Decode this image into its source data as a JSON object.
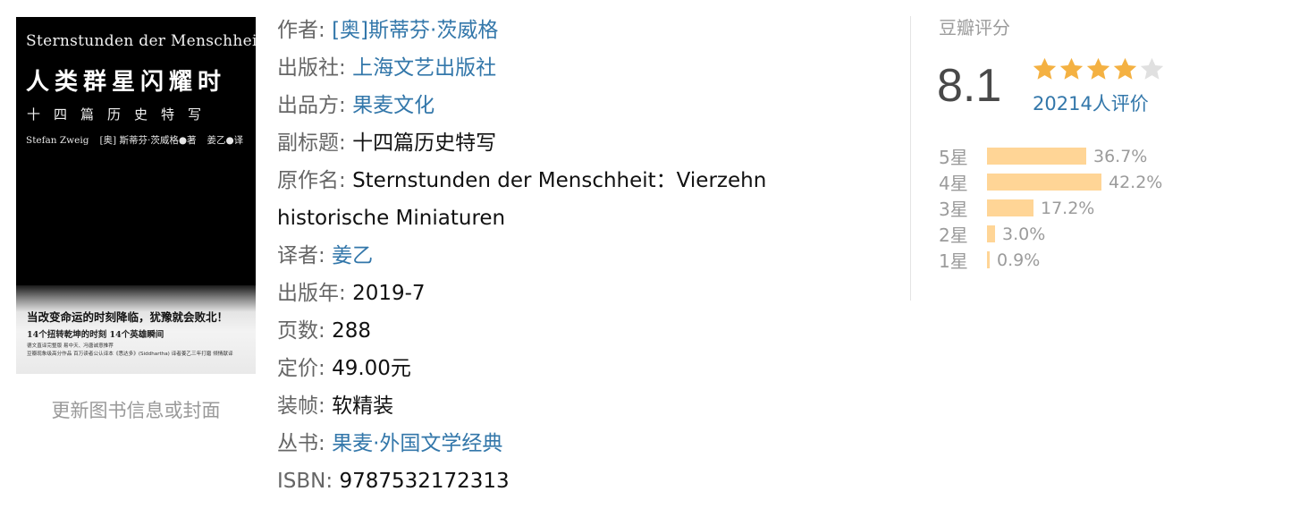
{
  "cover": {
    "en_title": "Sternstunden der Menschheit",
    "cn_title": "人类群星闪耀时",
    "subtitle": "十四篇历史特写",
    "author_en": "Stefan Zweig",
    "author_cn": "[奥] 斯蒂芬·茨威格●著",
    "translator_cn": "姜乙●译",
    "slogan": "当改变命运的时刻降临，犹豫就会败北！",
    "tagline": "14个扭转乾坤的时刻  14个英雄瞬间",
    "blurb_line1": "德文直译完整版 易中天、冯唐诚意推荐",
    "blurb_line2": "豆瓣现象级高分作品 百万读者公认译本《悉达多》(Siddhartha) 译者姜乙三年打磨 倾情献译"
  },
  "update_link": "更新图书信息或封面",
  "info": {
    "author_label": "作者:",
    "author_value": "[奥]斯蒂芬·茨威格",
    "publisher_label": "出版社:",
    "publisher_value": "上海文艺出版社",
    "producer_label": "出品方:",
    "producer_value": "果麦文化",
    "subtitle_label": "副标题:",
    "subtitle_value": "十四篇历史特写",
    "original_label": "原作名:",
    "original_value": "Sternstunden der Menschheit：Vierzehn historische Miniaturen",
    "translator_label": "译者:",
    "translator_value": "姜乙",
    "year_label": "出版年:",
    "year_value": "2019-7",
    "pages_label": "页数:",
    "pages_value": "288",
    "price_label": "定价:",
    "price_value": "49.00元",
    "binding_label": "装帧:",
    "binding_value": "软精装",
    "series_label": "丛书:",
    "series_value": "果麦·外国文学经典",
    "isbn_label": "ISBN:",
    "isbn_value": "9787532172313"
  },
  "rating": {
    "title": "豆瓣评分",
    "score": "8.1",
    "stars_filled": 4,
    "stars_total": 5,
    "count": "20214人评价",
    "star_color": "#f4b142",
    "star_empty_color": "#e0e0e0",
    "bar_color": "#ffd596",
    "link_color": "#3377aa",
    "distribution": [
      {
        "label": "5星",
        "percent": "36.7%",
        "value": 36.7
      },
      {
        "label": "4星",
        "percent": "42.2%",
        "value": 42.2
      },
      {
        "label": "3星",
        "percent": "17.2%",
        "value": 17.2
      },
      {
        "label": "2星",
        "percent": "3.0%",
        "value": 3.0
      },
      {
        "label": "1星",
        "percent": "0.9%",
        "value": 0.9
      }
    ]
  }
}
